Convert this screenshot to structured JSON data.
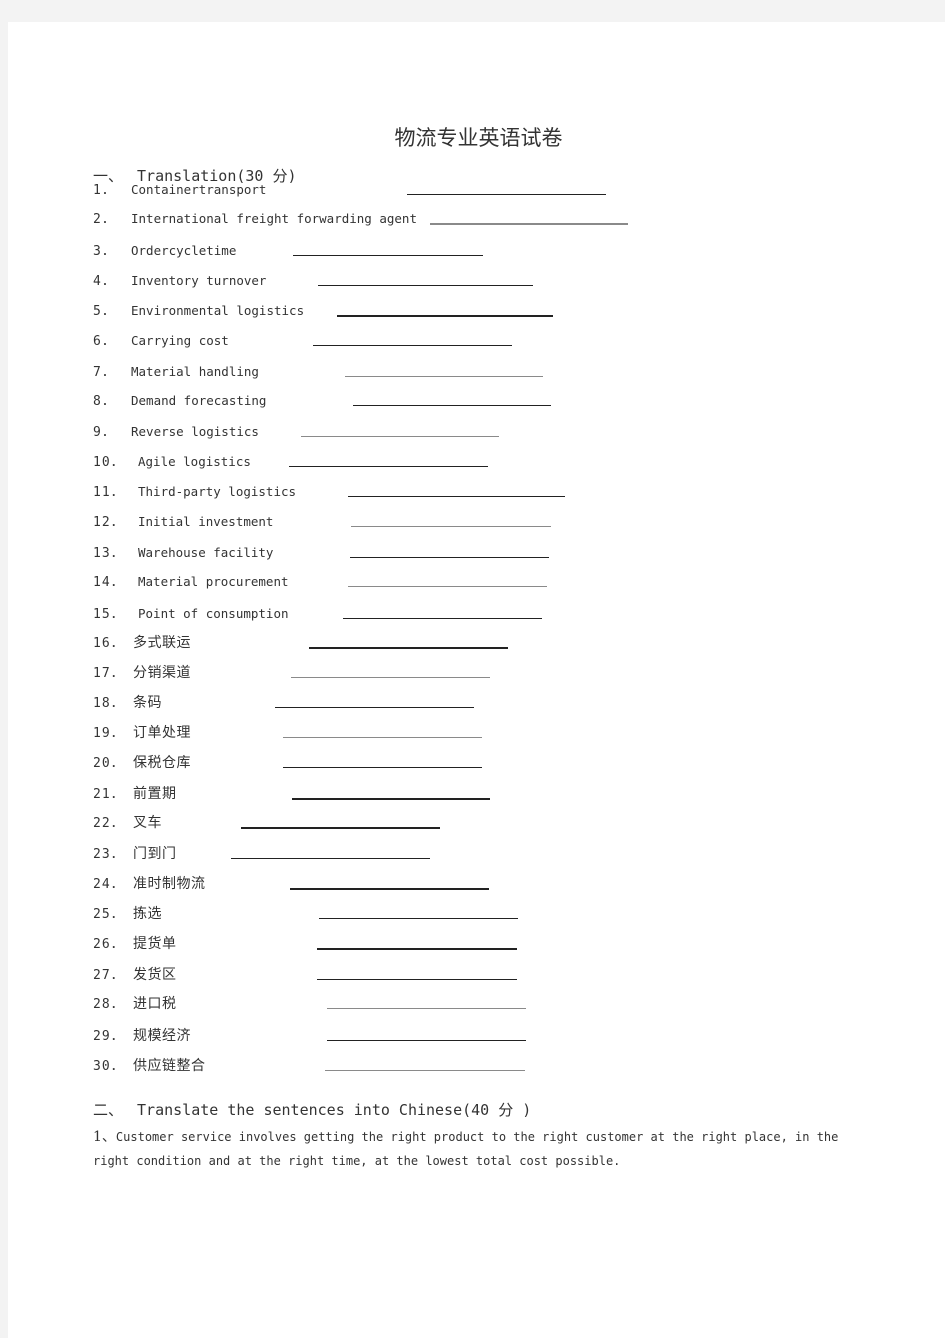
{
  "document": {
    "title": "物流专业英语试卷",
    "section1": {
      "number": "一、",
      "heading": "Translation(30 分)"
    },
    "items": [
      {
        "idx": "1．",
        "term": "Containertransport"
      },
      {
        "idx": "2．",
        "term": "International freight forwarding agent"
      },
      {
        "idx": "3．",
        "term": "Ordercycletime"
      },
      {
        "idx": "4．",
        "term": "Inventory turnover"
      },
      {
        "idx": "5．",
        "term": "Environmental logistics"
      },
      {
        "idx": "6．",
        "term": "Carrying cost"
      },
      {
        "idx": "7．",
        "term": "Material handling"
      },
      {
        "idx": "8．",
        "term": "Demand forecasting"
      },
      {
        "idx": "9．",
        "term": "Reverse logistics"
      },
      {
        "idx": "10．",
        "term": "Agile logistics"
      },
      {
        "idx": "11．",
        "term": "Third-party logistics"
      },
      {
        "idx": "12．",
        "term": "Initial investment"
      },
      {
        "idx": "13．",
        "term": "Warehouse facility"
      },
      {
        "idx": "14．",
        "term": "Material procurement"
      },
      {
        "idx": "15．",
        "term": "Point of consumption"
      },
      {
        "idx": "16．",
        "term": "多式联运"
      },
      {
        "idx": "17．",
        "term": "分销渠道"
      },
      {
        "idx": "18．",
        "term": "条码"
      },
      {
        "idx": "19．",
        "term": "订单处理"
      },
      {
        "idx": "20．",
        "term": "保税仓库"
      },
      {
        "idx": "21．",
        "term": "前置期"
      },
      {
        "idx": "22．",
        "term": "叉车"
      },
      {
        "idx": "23．",
        "term": "门到门"
      },
      {
        "idx": "24．",
        "term": "准时制物流"
      },
      {
        "idx": "25．",
        "term": "拣选"
      },
      {
        "idx": "26．",
        "term": "提货单"
      },
      {
        "idx": "27．",
        "term": "发货区"
      },
      {
        "idx": "28．",
        "term": "进口税"
      },
      {
        "idx": "29．",
        "term": "规模经济"
      },
      {
        "idx": "30．",
        "term": "供应链整合"
      }
    ],
    "section2": {
      "number": "二、",
      "heading": "Translate the sentences into Chinese(40 分 )"
    },
    "sentences": [
      {
        "idx": "1、",
        "text": "Customer service involves getting the right product to the right customer at the right place, in the right condition and at the right time, at the lowest total cost possible."
      }
    ]
  }
}
